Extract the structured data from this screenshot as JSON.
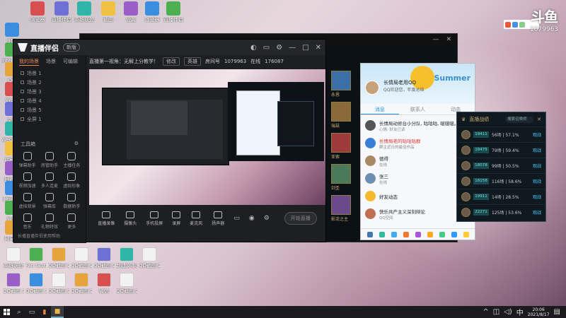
{
  "watermark": {
    "brand": "斗鱼",
    "room_id": "1079963"
  },
  "desktop_icons": [
    {
      "label": "360"
    },
    {
      "label": "Intel Graphics"
    },
    {
      "label": "QQ"
    },
    {
      "label": "Word"
    },
    {
      "label": "文件"
    },
    {
      "label": "WeGame"
    },
    {
      "label": "此电脑"
    },
    {
      "label": "回收站"
    },
    {
      "label": "腾讯QQ"
    },
    {
      "label": "微信"
    },
    {
      "label": "网易云"
    },
    {
      "label": "浏览器"
    },
    {
      "label": "直播伴侣"
    },
    {
      "label": "英雄联盟"
    },
    {
      "label": "截图"
    },
    {
      "label": "设置"
    }
  ],
  "desktop_bottom_icons": [
    {
      "label": "英雄联盟"
    },
    {
      "label": "Fan Guard"
    },
    {
      "label": "QQ截图 20210617"
    },
    {
      "label": "QQ截图 20210617"
    },
    {
      "label": "QQ截图 20210818"
    },
    {
      "label": "新建文本文档"
    },
    {
      "label": "QQ截图 20210617"
    },
    {
      "label": "QQ截图 20210817"
    },
    {
      "label": "QQ截图 20210817"
    },
    {
      "label": "QQ截图 20210817"
    },
    {
      "label": "QQ截图 20210817"
    },
    {
      "label": "微信"
    },
    {
      "label": "QQ截图 20210817"
    }
  ],
  "live_app": {
    "title": "直播伴侣",
    "version": "新版",
    "left_tabs": [
      "我的场景",
      "场景",
      "可编辑"
    ],
    "scenes": [
      "场景 1",
      "场景 2",
      "场景 3",
      "场景 4",
      "场景 5",
      "全屏 1"
    ],
    "tools_title": "工具箱",
    "tools": [
      {
        "label": "弹幕助手"
      },
      {
        "label": "房管助手"
      },
      {
        "label": "主播任务"
      },
      {
        "label": "视频加速"
      },
      {
        "label": "多人连麦"
      },
      {
        "label": "虚拟形象"
      },
      {
        "label": "虚拟背景"
      },
      {
        "label": "弹幕库"
      },
      {
        "label": "数据助手"
      },
      {
        "label": "音乐"
      },
      {
        "label": "礼物特效"
      },
      {
        "label": "更多"
      }
    ],
    "footer_text": "长播直播伴侣使用帮助",
    "stream_title": "直播第一视角：无解上分教学！",
    "edit_chip": "修改",
    "category_chip": "英雄",
    "room_label": "房间号",
    "room_id": "1079963",
    "online_label": "在线",
    "online_count": "176087",
    "bottom_actions": [
      {
        "label": "直播录像"
      },
      {
        "label": "摄像头"
      },
      {
        "label": "手机投屏"
      },
      {
        "label": "录屏"
      },
      {
        "label": "麦克风"
      },
      {
        "label": "扬声器"
      }
    ],
    "go_live": "开始直播"
  },
  "qq": {
    "nickname": "长情局老用QQ",
    "signature": "QQ欢迎您，年度总结",
    "theme": "Summer",
    "tabs": [
      "消息",
      "联系人",
      "动态"
    ],
    "active_tab": "消息",
    "items": [
      {
        "title": "长情局动修台小分队, 咕咕咕, 啵啵啵。",
        "subtitle": "心情: 好友已读",
        "red": false
      },
      {
        "title": "长情局老的咕咕咕群",
        "subtitle": "群主近日的最佳作品",
        "red": true
      },
      {
        "title": "德得",
        "subtitle": "在线",
        "red": false
      },
      {
        "title": "张三",
        "subtitle": "在线",
        "red": false
      },
      {
        "title": "好友动态",
        "subtitle": "",
        "red": false
      },
      {
        "title": "快乐共产主义深刻辩论",
        "subtitle": "QQ空间",
        "red": false
      }
    ]
  },
  "rank": {
    "title": "直播战绩",
    "search_placeholder": "搜索召唤师",
    "rows": [
      {
        "id": "19411",
        "stat": "56场 | 57.1%",
        "action": "观战"
      },
      {
        "id": "18475",
        "stat": "79场 | 59.4%",
        "action": "观战"
      },
      {
        "id": "18078",
        "stat": "99场 | 50.5%",
        "action": "观战"
      },
      {
        "id": "18158",
        "stat": "116场 | 58.6%",
        "action": "观战"
      },
      {
        "id": "19911",
        "stat": "14场 | 28.5%",
        "action": "观战"
      },
      {
        "id": "22271",
        "stat": "125场 | 53.6%",
        "action": "观战"
      }
    ]
  },
  "game": {
    "heroes": [
      "永恩",
      "瑞兹",
      "亚索",
      "剑圣",
      "影流之主"
    ]
  },
  "taskbar": {
    "time": "20:06",
    "date": "2021/8/17"
  },
  "colors": {
    "accent": "#e8834a",
    "qq_blue": "#1a8fe3",
    "rank_gold": "#c8aa6e"
  }
}
